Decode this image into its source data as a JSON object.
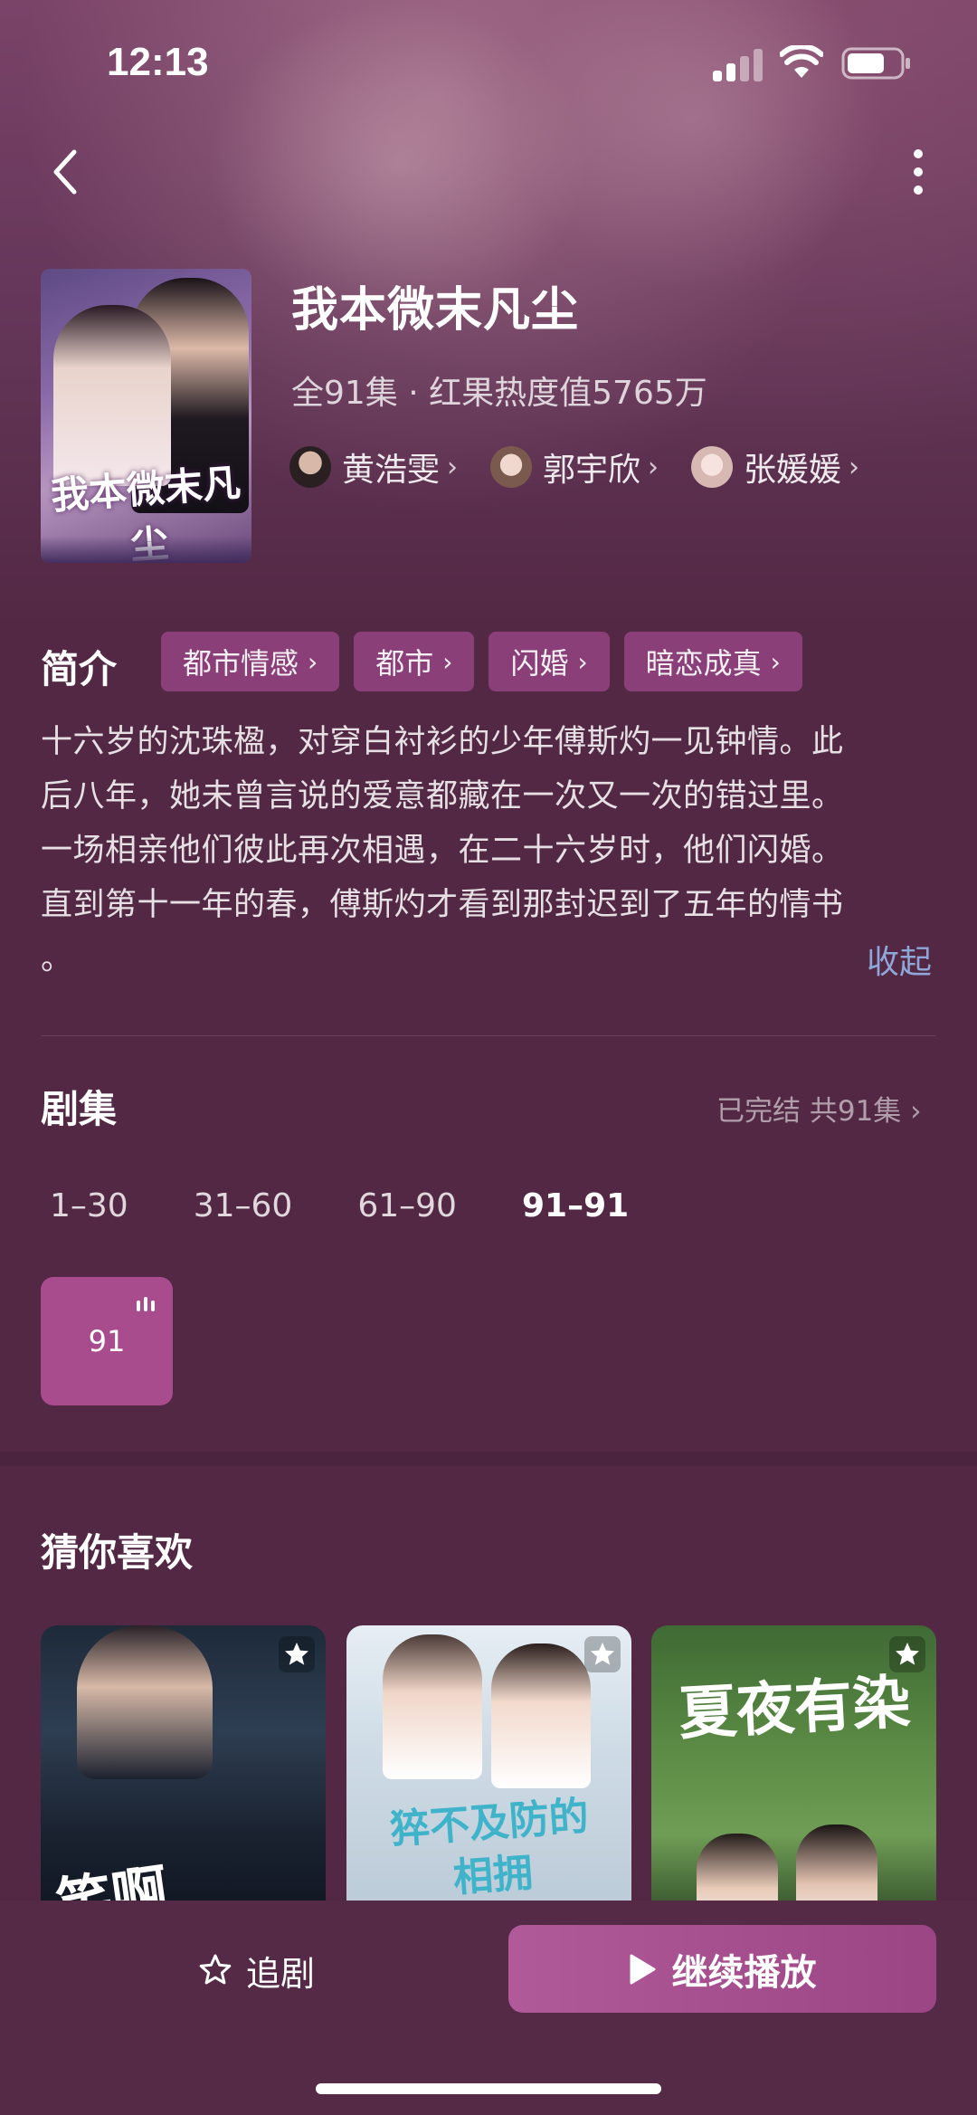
{
  "status_bar": {
    "time": "12:13"
  },
  "show": {
    "title": "我本微末凡尘",
    "meta": "全91集 · 红果热度值5765万",
    "poster_title": "我本微末凡尘",
    "cast": [
      {
        "name": "黄浩雯",
        "avatar_color": "#6d5b58"
      },
      {
        "name": "郭宇欣",
        "avatar_color": "#c9a79e"
      },
      {
        "name": "张媛媛",
        "avatar_color": "#e6c8c6"
      }
    ]
  },
  "synopsis": {
    "heading": "简介",
    "tags": [
      "都市情感",
      "都市",
      "闪婚",
      "暗恋成真"
    ],
    "lines": [
      "十六岁的沈珠楹，对穿白衬衫的少年傅斯灼一见钟情。此",
      "后八年，她未曾言说的爱意都藏在一次又一次的错过里。",
      "一场相亲他们彼此再次相遇，在二十六岁时，他们闪婚。",
      "直到第十一年的春，傅斯灼才看到那封迟到了五年的情书",
      "。"
    ],
    "collapse_label": "收起"
  },
  "episodes": {
    "heading": "剧集",
    "status": "已完结 共91集",
    "ranges": [
      "1–30",
      "31–60",
      "61–90",
      "91–91"
    ],
    "active_range_index": 3,
    "tiles": [
      "91"
    ]
  },
  "recommend": {
    "heading": "猜你喜欢",
    "cards": [
      {
        "title": "笑啊"
      },
      {
        "title": "猝不及防的相拥"
      },
      {
        "title": "夏夜有染"
      }
    ]
  },
  "bottom_bar": {
    "follow_label": "追剧",
    "continue_label": "继续播放"
  },
  "colors": {
    "background": "#522844",
    "accent": "#a84c8e",
    "tag_bg": "#8a3f78",
    "link": "#8fa6d6"
  }
}
